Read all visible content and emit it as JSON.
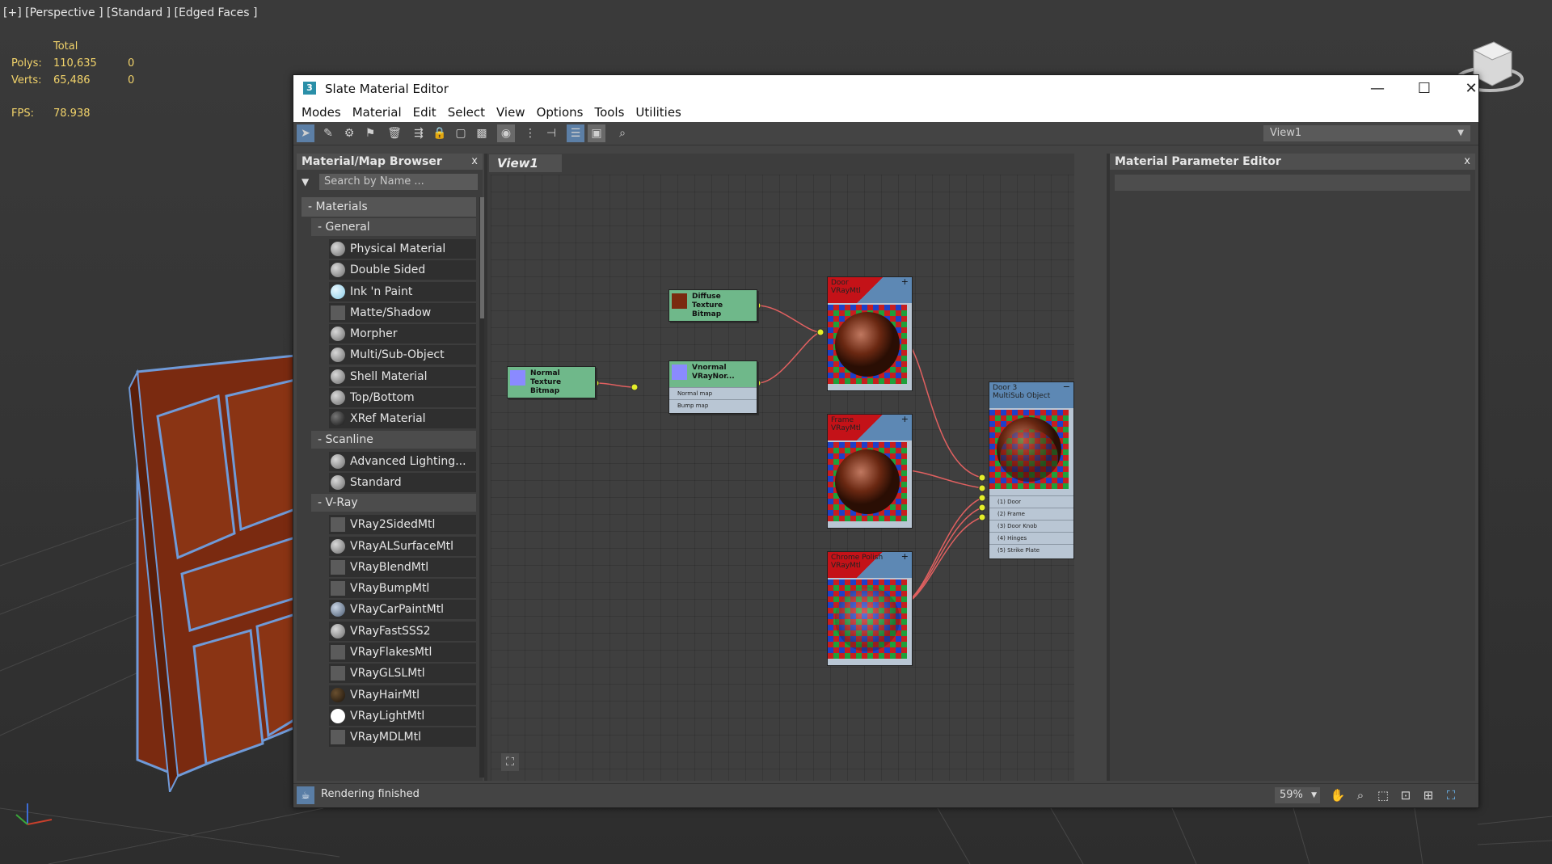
{
  "viewport": {
    "label": "[+] [Perspective ] [Standard ] [Edged Faces ]",
    "stats": {
      "header": "Total",
      "rows": [
        {
          "label": "Polys:",
          "total": "110,635",
          "sel": "0"
        },
        {
          "label": "Verts:",
          "total": "65,486",
          "sel": "0"
        }
      ],
      "fps_label": "FPS:",
      "fps_value": "78.938"
    }
  },
  "window": {
    "title": "Slate Material Editor",
    "app_icon": "3",
    "minimize_icon": "—",
    "maximize_icon": "☐",
    "close_icon": "✕"
  },
  "menu": [
    "Modes",
    "Material",
    "Edit",
    "Select",
    "View",
    "Options",
    "Tools",
    "Utilities"
  ],
  "toolbar": {
    "view_selector": "View1",
    "icons": [
      "select-icon",
      "pick-icon",
      "put-to-scene-icon",
      "assign-icon",
      "delete-icon",
      "move-children-icon",
      "lock-icon",
      "show-map-icon",
      "background-icon",
      "sample-type-icon",
      "layout-icon",
      "layout-children-icon",
      "node-editor-icon",
      "material-editor-icon",
      "search-icon"
    ]
  },
  "browser": {
    "title": "Material/Map Browser",
    "close": "x",
    "search_placeholder": "Search by Name ...",
    "root_group": "Materials",
    "groups": [
      {
        "name": "General",
        "items": [
          {
            "label": "Physical Material",
            "swatch": "#8a8a8a"
          },
          {
            "label": "Double Sided",
            "swatch": "#8a8a8a"
          },
          {
            "label": "Ink 'n Paint",
            "swatch": "#a8dcf0"
          },
          {
            "label": "Matte/Shadow",
            "swatch": "sq"
          },
          {
            "label": "Morpher",
            "swatch": "#8a8a8a"
          },
          {
            "label": "Multi/Sub-Object",
            "swatch": "#8a8a8a"
          },
          {
            "label": "Shell Material",
            "swatch": "#8a8a8a"
          },
          {
            "label": "Top/Bottom",
            "swatch": "#8a8a8a"
          },
          {
            "label": "XRef Material",
            "swatch": "#1c1c1c"
          }
        ]
      },
      {
        "name": "Scanline",
        "items": [
          {
            "label": "Advanced Lighting...",
            "swatch": "#8a8a8a"
          },
          {
            "label": "Standard",
            "swatch": "#8a8a8a"
          }
        ]
      },
      {
        "name": "V-Ray",
        "items": [
          {
            "label": "VRay2SidedMtl",
            "swatch": "sq"
          },
          {
            "label": "VRayALSurfaceMtl",
            "swatch": "#8a8a8a"
          },
          {
            "label": "VRayBlendMtl",
            "swatch": "sq"
          },
          {
            "label": "VRayBumpMtl",
            "swatch": "sq"
          },
          {
            "label": "VRayCarPaintMtl",
            "swatch": "#7a8aa0"
          },
          {
            "label": "VRayFastSSS2",
            "swatch": "#8a8a8a"
          },
          {
            "label": "VRayFlakesMtl",
            "swatch": "sq"
          },
          {
            "label": "VRayGLSLMtl",
            "swatch": "sq"
          },
          {
            "label": "VRayHairMtl",
            "swatch": "#3a2a1a"
          },
          {
            "label": "VRayLightMtl",
            "swatch": "#ffffff"
          },
          {
            "label": "VRayMDLMtl",
            "swatch": "sq"
          }
        ]
      }
    ]
  },
  "view": {
    "tab": "View1",
    "nodes": {
      "normal_texture": [
        "Normal Texture",
        "Bitmap"
      ],
      "diffuse_texture": [
        "Diffuse Texture",
        "Bitmap"
      ],
      "vnormal": [
        "Vnormal",
        "VRayNor..."
      ],
      "vnormal_slots": [
        "Normal map",
        "Bump map"
      ],
      "door": [
        "Door",
        "VRayMtl"
      ],
      "frame": [
        "Frame",
        "VRayMtl"
      ],
      "chrome": [
        "Chrome Polish",
        "VRayMtl"
      ],
      "multi": [
        "Door 3",
        "MultiSub Object"
      ],
      "multi_slots": [
        "(1) Door",
        "(2) Frame",
        "(3) Door Knob",
        "(4) Hinges",
        "(5) Strike Plate"
      ]
    }
  },
  "param_editor": {
    "title": "Material Parameter Editor",
    "close": "x"
  },
  "status": {
    "text": "Rendering finished",
    "zoom": "59%"
  }
}
